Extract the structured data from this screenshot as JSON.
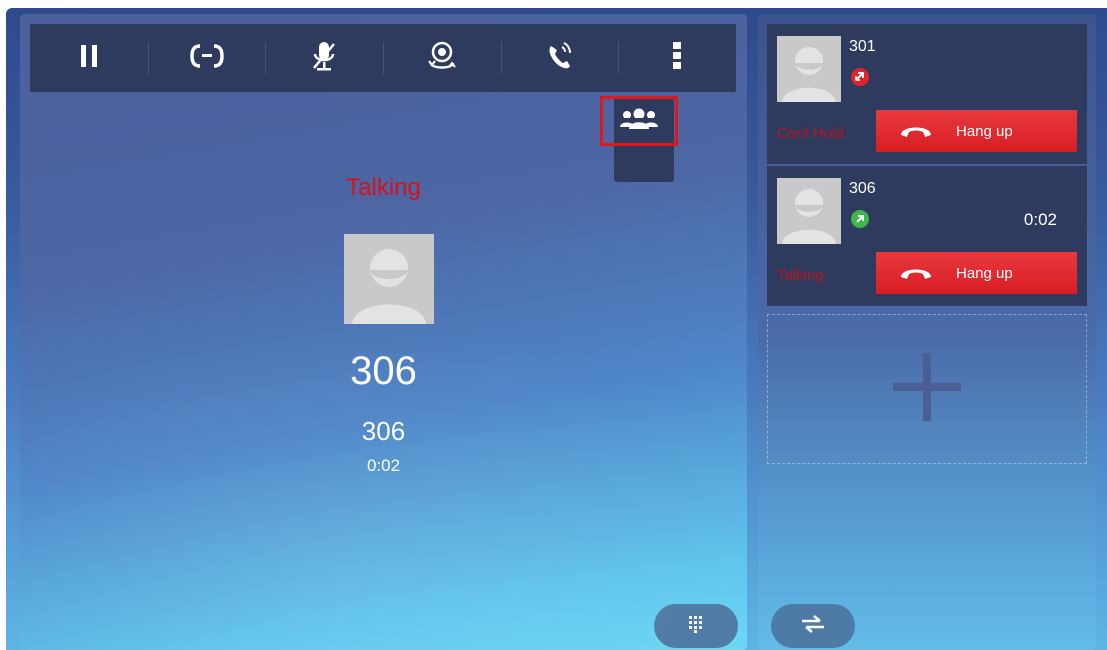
{
  "toolbar": {
    "items": [
      {
        "icon": "pause-icon"
      },
      {
        "icon": "transfer-icon"
      },
      {
        "icon": "mute-icon"
      },
      {
        "icon": "video-icon"
      },
      {
        "icon": "call-audio-icon"
      },
      {
        "icon": "more-icon"
      }
    ],
    "dropdown": {
      "icon": "conference-icon"
    }
  },
  "main_call": {
    "status": "Talking",
    "name": "306",
    "number": "306",
    "duration": "0:02"
  },
  "call_list": [
    {
      "number": "301",
      "status_icon": "hold-badge-icon",
      "state": "Conf Hold",
      "time": "",
      "hangup_label": "Hang up"
    },
    {
      "number": "306",
      "status_icon": "outgoing-badge-icon",
      "state": "Talking",
      "time": "0:02",
      "hangup_label": "Hang up"
    }
  ],
  "colors": {
    "toolbar_bg": "#2f3b5e",
    "status_red": "#d8101a",
    "hangup_red": "#d81d23",
    "highlight_red": "#e1171e"
  }
}
